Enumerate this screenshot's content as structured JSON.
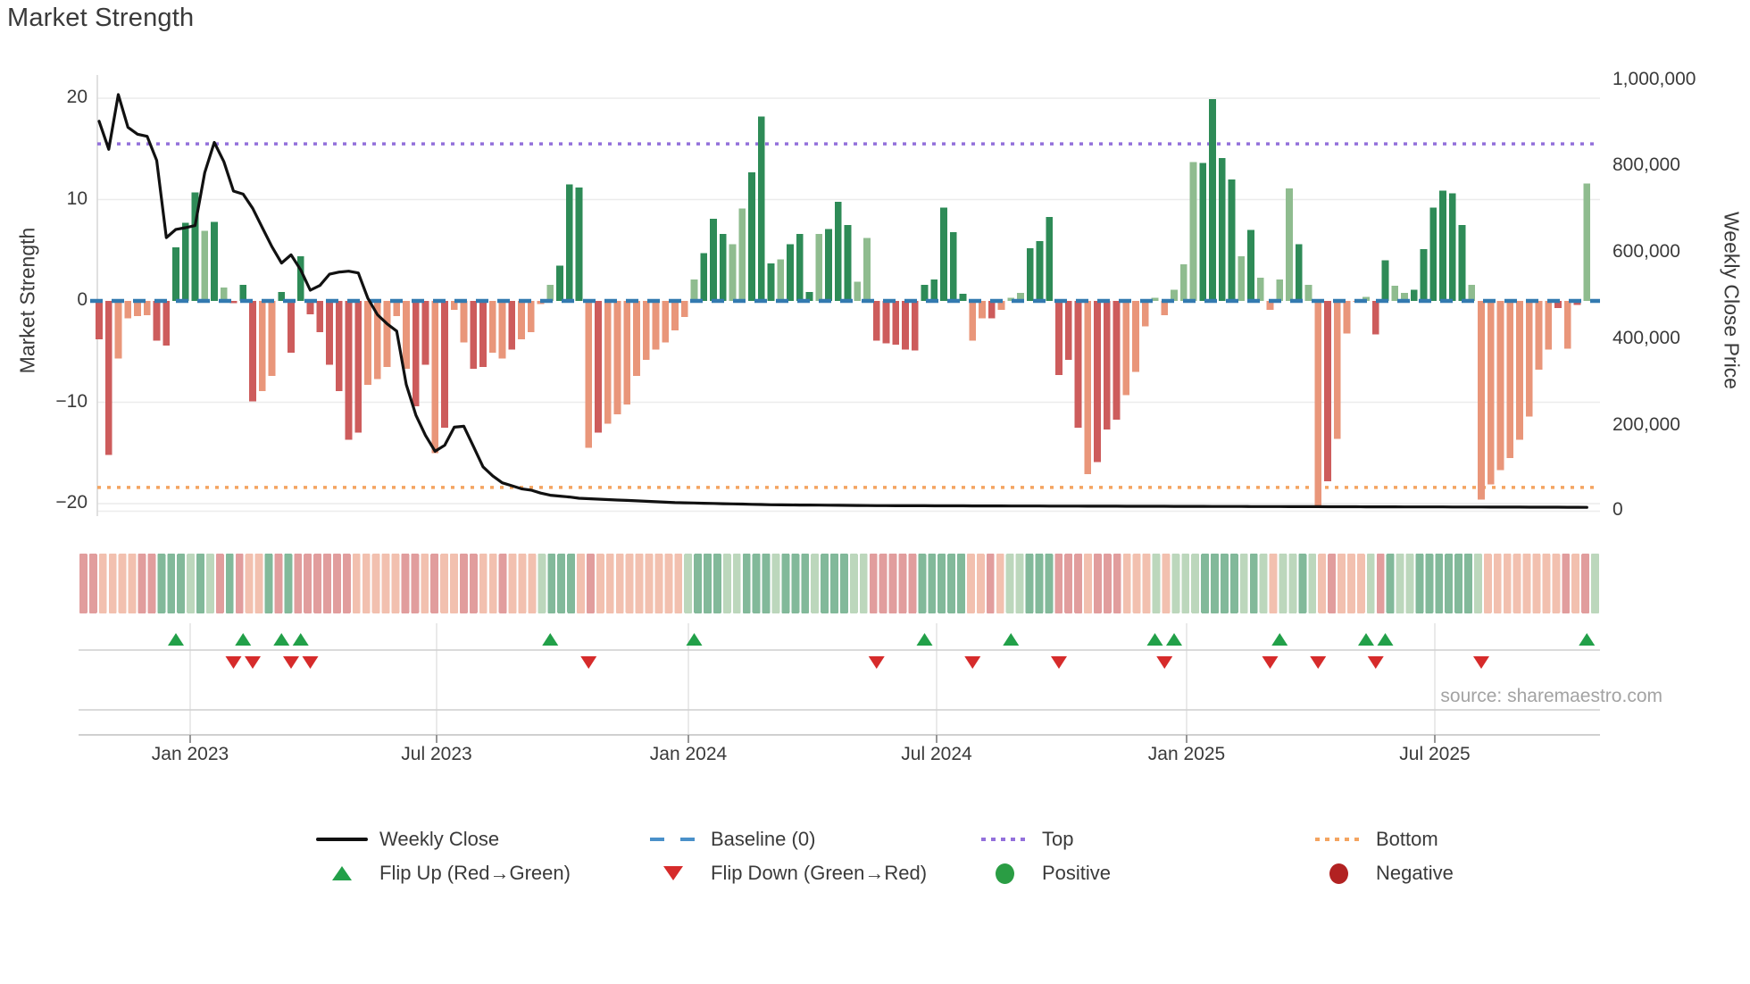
{
  "title": "Market Strength",
  "source_text": "source: sharemaestro.com",
  "axes": {
    "left_label": "Market Strength",
    "right_label": "Weekly Close Price",
    "left_ticks": [
      "20",
      "10",
      "0",
      "−10",
      "−20"
    ],
    "right_ticks": [
      "1,000,000",
      "800,000",
      "600,000",
      "400,000",
      "200,000",
      "0"
    ],
    "x_ticks": [
      "Jan 2023",
      "Jul 2023",
      "Jan 2024",
      "Jul 2024",
      "Jan 2025",
      "Jul 2025"
    ]
  },
  "legend": {
    "row1": [
      {
        "label": "Weekly Close",
        "marker": "line",
        "color": "#111111"
      },
      {
        "label": "Baseline (0)",
        "marker": "dashes",
        "color": "#4a90c9"
      },
      {
        "label": "Top",
        "marker": "dots",
        "color": "#9370db"
      },
      {
        "label": "Bottom",
        "marker": "dots",
        "color": "#f4a460"
      }
    ],
    "row2": [
      {
        "label": "Flip Up (Red→Green)",
        "marker": "triangle-up",
        "color": "#22a049"
      },
      {
        "label": "Flip Down (Green→Red)",
        "marker": "triangle-down",
        "color": "#d62b2b"
      },
      {
        "label": "Positive",
        "marker": "circle",
        "color": "#2a9d44"
      },
      {
        "label": "Negative",
        "marker": "circle",
        "color": "#b22222"
      }
    ]
  },
  "colors": {
    "pos_dark": "#2e8b57",
    "pos_light": "#8fbc8f",
    "neg_dark": "#cd5c5c",
    "neg_light": "#e9967a",
    "baseline": "#337ab0",
    "top_line": "#9370db",
    "bottom_line": "#f4a460",
    "close_line": "#111111",
    "flip_up": "#22a049",
    "flip_down": "#d62b2b",
    "grid": "#ececec",
    "spine": "#d8d8d8",
    "panel_line": "#cfcfcf"
  },
  "chart_data": {
    "type": "bar+line+heatmap",
    "title": "Market Strength",
    "ylabel_left": "Market Strength",
    "ylabel_right": "Weekly Close Price",
    "ylim_left": [
      -22,
      22
    ],
    "ylim_right": [
      0,
      1000000
    ],
    "x_tick_labels": [
      "Jan 2023",
      "Jul 2023",
      "Jan 2024",
      "Jul 2024",
      "Jan 2025",
      "Jul 2025"
    ],
    "frequency": "weekly",
    "baseline": 0,
    "top_level": 15.5,
    "bottom_level": -18.4,
    "strength_values": [
      -3.8,
      -15.2,
      -5.7,
      -1.7,
      -1.5,
      -1.4,
      -3.9,
      -4.4,
      5.3,
      7.7,
      10.7,
      6.9,
      7.8,
      1.3,
      -0.2,
      1.6,
      -9.9,
      -8.9,
      -7.4,
      0.9,
      -5.1,
      4.4,
      -1.3,
      -3.1,
      -6.3,
      -8.9,
      -13.7,
      -13.0,
      -8.3,
      -7.7,
      -6.5,
      -1.5,
      -6.7,
      -10.4,
      -6.3,
      -15.0,
      -12.5,
      -0.9,
      -4.1,
      -6.7,
      -6.5,
      -5.1,
      -5.7,
      -4.8,
      -3.8,
      -3.1,
      -0.3,
      1.6,
      3.5,
      11.5,
      11.2,
      -14.5,
      -13.0,
      -12.1,
      -11.2,
      -10.2,
      -7.4,
      -5.8,
      -4.8,
      -4.1,
      -2.9,
      -1.6,
      2.1,
      4.7,
      8.1,
      6.6,
      5.6,
      9.1,
      12.7,
      18.2,
      3.7,
      4.1,
      5.6,
      6.6,
      0.9,
      6.6,
      7.1,
      9.8,
      7.5,
      1.9,
      6.2,
      -3.9,
      -4.2,
      -4.3,
      -4.8,
      -4.9,
      1.6,
      2.1,
      9.2,
      6.8,
      0.7,
      -3.9,
      -1.7,
      -1.7,
      -0.9,
      0.3,
      0.8,
      5.2,
      5.9,
      8.3,
      -7.3,
      -5.8,
      -12.5,
      -17.1,
      -15.9,
      -12.7,
      -11.7,
      -9.3,
      -7.0,
      -2.5,
      0.3,
      -1.4,
      1.1,
      3.6,
      13.7,
      13.6,
      19.9,
      14.1,
      12.0,
      4.4,
      7.0,
      2.3,
      -0.9,
      2.1,
      11.1,
      5.6,
      1.6,
      -20.4,
      -17.8,
      -13.6,
      -3.2,
      -0.1,
      0.4,
      -3.3,
      4.0,
      1.5,
      0.8,
      1.1,
      5.1,
      9.2,
      10.9,
      10.6,
      7.5,
      1.6,
      -19.6,
      -18.1,
      -16.7,
      -15.5,
      -13.7,
      -11.4,
      -6.8,
      -4.8,
      -0.7,
      -4.7,
      -0.4,
      11.6
    ],
    "shades": "ddlllldddddldldddlldddddddddlllllddldllddlldlllldddldlllllllllldddlldddldddldddllddddddddddlldlllddddddldddllllllllddddldlllldlldllllddllddddddllllllllldld",
    "weekly_close_thousands": [
      905,
      840,
      967,
      891,
      875,
      870,
      814,
      635,
      654,
      658,
      663,
      786,
      856,
      811,
      743,
      736,
      703,
      658,
      614,
      576,
      595,
      560,
      513,
      524,
      550,
      555,
      557,
      553,
      494,
      456,
      435,
      418,
      294,
      223,
      176,
      139,
      153,
      195,
      197,
      150,
      103,
      82,
      66,
      59,
      52,
      49,
      42,
      37,
      35,
      33,
      30,
      29,
      28,
      27,
      26,
      25,
      24,
      23,
      22,
      21,
      20,
      19.5,
      19,
      18.5,
      18,
      17.5,
      17,
      16.5,
      16,
      15.5,
      15,
      14.8,
      14.6,
      14.4,
      14.2,
      14,
      13.8,
      13.6,
      13.4,
      13.2,
      13,
      12.8,
      12.75,
      12.7,
      12.65,
      12.6,
      12.55,
      12.5,
      12.45,
      12.4,
      12.35,
      12.3,
      12.25,
      12.2,
      12.15,
      12.1,
      12.05,
      12,
      11.95,
      11.9,
      11.85,
      11.8,
      11.75,
      11.7,
      11.65,
      11.6,
      11.55,
      11.5,
      11.45,
      11.4,
      11.35,
      11.3,
      11.25,
      11.2,
      11.15,
      11.1,
      11.05,
      11,
      10.95,
      10.9,
      10.85,
      10.8,
      10.75,
      10.7,
      10.65,
      10.6,
      10.55,
      10.5,
      10.45,
      10.4,
      10.35,
      10.3,
      10.25,
      10.2,
      10.15,
      10.1,
      10.05,
      10,
      9.95,
      9.9,
      9.85,
      9.8,
      9.75,
      9.7,
      9.65,
      9.6,
      9.55,
      9.5,
      9.45,
      9.4,
      9.35,
      9.3,
      9.25,
      9.2,
      9.1,
      9.0
    ],
    "flip_up_weeks": [
      8,
      15,
      19,
      21,
      47,
      62,
      86,
      95,
      110,
      112,
      123,
      132,
      134,
      155
    ],
    "flip_down_weeks": [
      14,
      16,
      20,
      22,
      51,
      81,
      91,
      100,
      111,
      122,
      127,
      133,
      144
    ],
    "heatmap": "same weekly values rendered as muted red/green cells"
  }
}
